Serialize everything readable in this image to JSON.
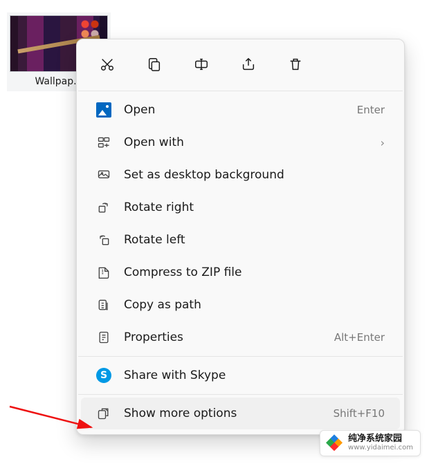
{
  "desktop_icon": {
    "label": "Wallpap..."
  },
  "action_row": {
    "cut": "cut",
    "copy": "copy",
    "rename": "rename",
    "share": "share",
    "delete": "delete"
  },
  "menu": {
    "open": {
      "label": "Open",
      "shortcut": "Enter"
    },
    "open_with": {
      "label": "Open with",
      "has_submenu": true
    },
    "set_bg": {
      "label": "Set as desktop background"
    },
    "rotate_r": {
      "label": "Rotate right"
    },
    "rotate_l": {
      "label": "Rotate left"
    },
    "zip": {
      "label": "Compress to ZIP file"
    },
    "copy_path": {
      "label": "Copy as path"
    },
    "properties": {
      "label": "Properties",
      "shortcut": "Alt+Enter"
    },
    "skype": {
      "label": "Share with Skype"
    },
    "more": {
      "label": "Show more options",
      "shortcut": "Shift+F10"
    }
  },
  "watermark": {
    "title": "纯净系统家园",
    "url": "www.yidaimei.com"
  }
}
